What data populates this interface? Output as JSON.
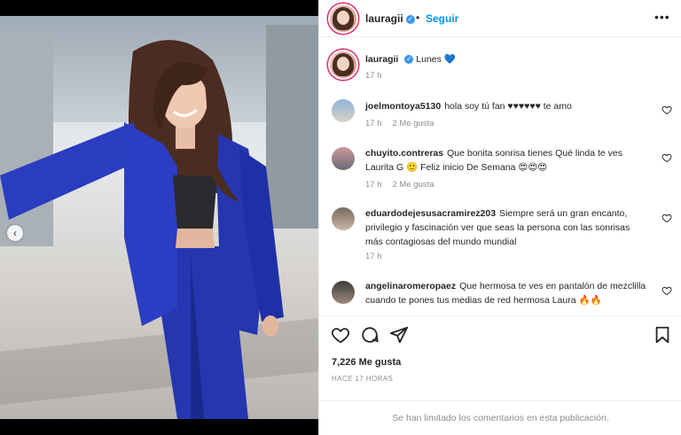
{
  "post": {
    "username": "lauragii",
    "follow_label": "Seguir",
    "separator": "•",
    "more_label": "•••",
    "caption_username": "lauragii",
    "caption_text": "Lunes 💙",
    "caption_time": "17 h",
    "likes": "7,226 Me gusta",
    "posted_ago": "HACE 17 HORAS",
    "comments_limited": "Se han limitado los comentarios en esta publicación."
  },
  "comments": [
    {
      "username": "joelmontoya5130",
      "text": "hola soy tú fan ♥♥♥♥♥♥ te amo",
      "time": "17 h",
      "likes": "2 Me gusta"
    },
    {
      "username": "chuyito.contreras",
      "text": "Que bonita sonrisa tienes Qué linda te ves Laurita G 🙂 Feliz inicio De Semana 😍😍😍",
      "time": "17 h",
      "likes": "2 Me gusta"
    },
    {
      "username": "eduardodejesusacramirez203",
      "text": "Siempre será un gran encanto, privilegio y fascinación ver que seas la persona con las sonrisas más contagiosas del mundo mundial",
      "time": "17 h",
      "likes": ""
    },
    {
      "username": "angelinaromeropaez",
      "text": "Que hermosa te ves en pantalón de mezclilla cuando te pones tus medias de red hermosa Laura 🔥🔥",
      "time": "",
      "likes": ""
    }
  ],
  "colors": {
    "accent": "#0095f6",
    "verified": "#3897f0",
    "blazer": "#2337b5",
    "muted": "#8e8e8e"
  },
  "icons": {
    "like": "heart-outline",
    "comment": "speech-bubble",
    "share": "paper-plane",
    "save": "bookmark",
    "prev": "chevron-left"
  }
}
